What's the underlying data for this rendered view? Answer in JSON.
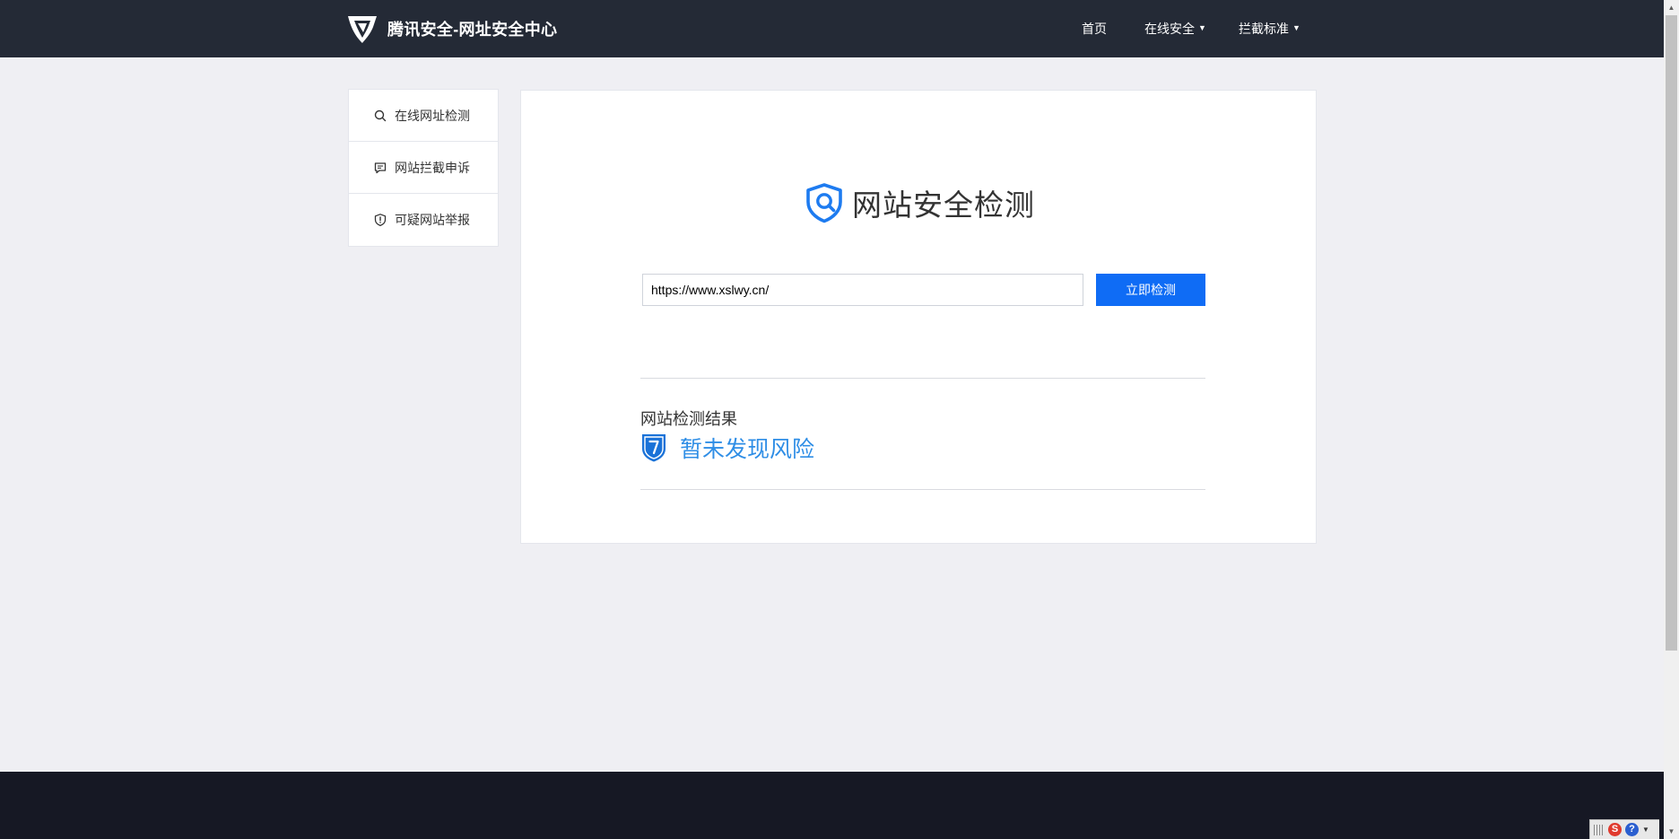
{
  "header": {
    "brand_title": "腾讯安全-网址安全中心",
    "nav": {
      "home": "首页",
      "online_security": "在线安全",
      "intercept_standard": "拦截标准"
    }
  },
  "sidebar": {
    "items": [
      {
        "label": "在线网址检测",
        "icon": "search-icon"
      },
      {
        "label": "网站拦截申诉",
        "icon": "message-icon"
      },
      {
        "label": "可疑网站举报",
        "icon": "shield-alert-icon"
      }
    ]
  },
  "main": {
    "heading": "网站安全检测",
    "url_input_value": "https://www.xslwy.cn/",
    "check_button": "立即检测",
    "result_label": "网站检测结果",
    "result_status": "暂未发现风险"
  },
  "tray": {
    "sogou_glyph": "S",
    "help_glyph": "?"
  },
  "colors": {
    "topbar": "#242a36",
    "accent": "#0f6cf5",
    "result_text": "#2f8ee6",
    "page_background": "#efeff3",
    "footer": "#161824"
  }
}
